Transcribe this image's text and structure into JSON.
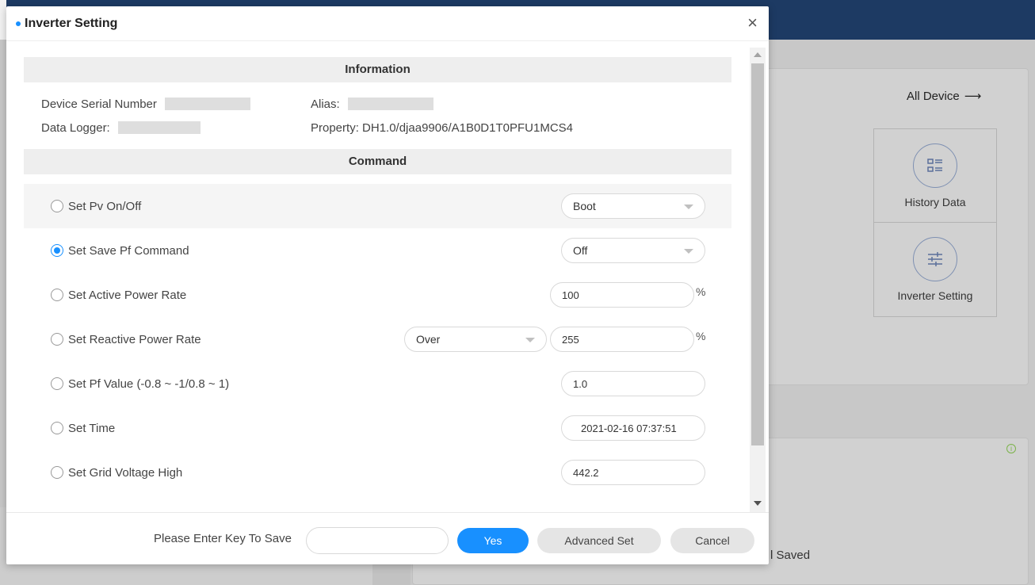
{
  "background": {
    "all_device": "All Device",
    "history_data": "History Data",
    "inverter_setting": "Inverter Setting",
    "saved": "l Saved"
  },
  "modal": {
    "title": "Inverter Setting",
    "close": "×",
    "info_section": "Information",
    "device_serial_label": "Device Serial Number",
    "alias_label": "Alias:",
    "data_logger_label": "Data Logger:",
    "property": "Property: DH1.0/djaa9906/A1B0D1T0PFU1MCS4",
    "command_section": "Command",
    "commands": [
      {
        "label": "Set Pv On/Off",
        "checked": false,
        "select": "Boot"
      },
      {
        "label": "Set Save Pf Command",
        "checked": true,
        "select": "Off"
      },
      {
        "label": "Set Active Power Rate",
        "checked": false,
        "value": "100",
        "unit": "%"
      },
      {
        "label": "Set Reactive Power Rate",
        "checked": false,
        "select": "Over",
        "value": "255",
        "unit": "%"
      },
      {
        "label": "Set Pf Value (-0.8 ~ -1/0.8 ~ 1)",
        "checked": false,
        "value": "1.0"
      },
      {
        "label": "Set Time",
        "checked": false,
        "value": "2021-02-16 07:37:51"
      },
      {
        "label": "Set Grid Voltage High",
        "checked": false,
        "value": "442.2"
      }
    ],
    "footer": {
      "key_label": "Please Enter Key To Save",
      "key_placeholder": "",
      "yes": "Yes",
      "advanced": "Advanced Set",
      "cancel": "Cancel"
    }
  },
  "colors": {
    "accent": "#1890ff",
    "header_bg": "#1d3a63"
  }
}
